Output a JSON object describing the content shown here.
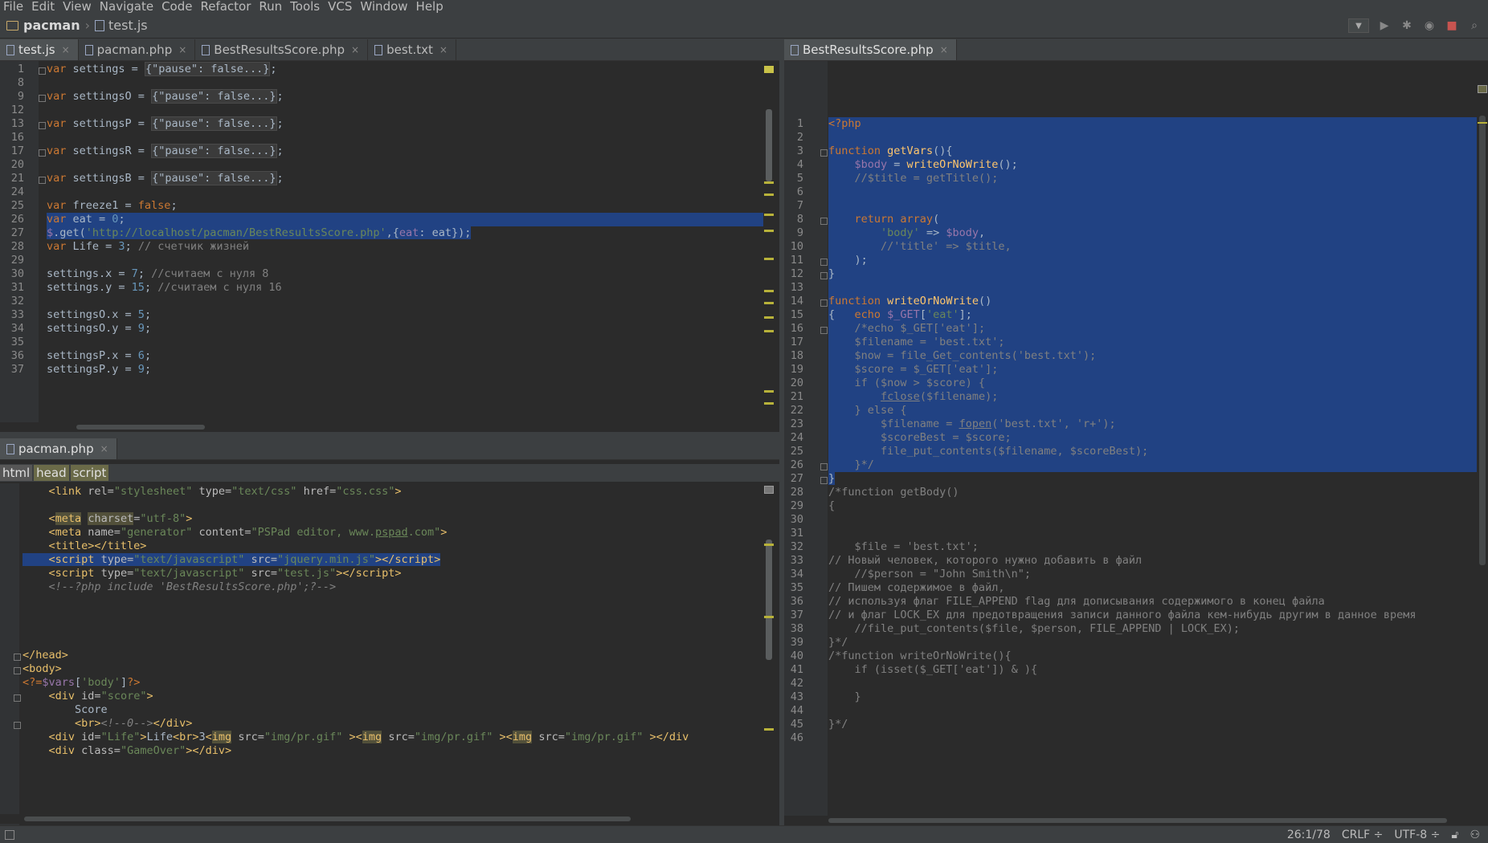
{
  "menu": [
    "File",
    "Edit",
    "View",
    "Navigate",
    "Code",
    "Refactor",
    "Run",
    "Tools",
    "VCS",
    "Window",
    "Help"
  ],
  "menu_underline": [
    "F",
    "E",
    "V",
    "N",
    "C",
    "R",
    "R",
    "T",
    "S",
    "W",
    "H"
  ],
  "nav": {
    "project": "pacman",
    "file": "test.js"
  },
  "left_top_tabs": [
    {
      "label": "test.js",
      "active": true
    },
    {
      "label": "pacman.php",
      "active": false
    },
    {
      "label": "BestResultsScore.php",
      "active": false
    },
    {
      "label": "best.txt",
      "active": false
    }
  ],
  "left_bottom_tabs": [
    {
      "label": "pacman.php",
      "active": true
    }
  ],
  "right_tabs": [
    {
      "label": "BestResultsScore.php",
      "active": true
    }
  ],
  "html_breadcrumb": [
    "html",
    "head",
    "script"
  ],
  "status": {
    "position": "26:1/78",
    "line_sep": "CRLF ÷",
    "encoding": "UTF-8 ÷"
  },
  "editor_top": {
    "lines": [
      {
        "n": "1",
        "h": "<span class='kw'>var</span> settings = <span class='fd'>{\"pause\": false...}</span>;",
        "fold": true
      },
      {
        "n": "8",
        "h": ""
      },
      {
        "n": "9",
        "h": "<span class='kw'>var</span> settingsO = <span class='fd'>{\"pause\": false...}</span>;",
        "fold": true
      },
      {
        "n": "12",
        "h": ""
      },
      {
        "n": "13",
        "h": "<span class='kw'>var</span> settingsP = <span class='fd'>{\"pause\": false...}</span>;",
        "fold": true
      },
      {
        "n": "16",
        "h": ""
      },
      {
        "n": "17",
        "h": "<span class='kw'>var</span> settingsR = <span class='fd'>{\"pause\": false...}</span>;",
        "fold": true
      },
      {
        "n": "20",
        "h": ""
      },
      {
        "n": "21",
        "h": "<span class='kw'>var</span> settingsB = <span class='fd'>{\"pause\": false...}</span>;",
        "fold": true
      },
      {
        "n": "24",
        "h": ""
      },
      {
        "n": "25",
        "h": "<span class='kw'>var</span> freeze1 = <span class='kw'>false</span>;"
      },
      {
        "n": "26",
        "h": "<span class='kw'>var</span> eat = <span class='num'>0</span>;",
        "sel": "full"
      },
      {
        "n": "27",
        "h": "<span class='var'>$</span>.get(<span class='str'>'http://localhost/pacman/BestResultsScore.php'</span>,{<span class='var'>eat</span>: eat});",
        "sel": "text"
      },
      {
        "n": "28",
        "h": "<span class='kw'>var</span> Life = <span class='num'>3</span>; <span class='cmt'>// счетчик жизней</span>"
      },
      {
        "n": "29",
        "h": ""
      },
      {
        "n": "30",
        "h": "settings.x = <span class='num'>7</span>; <span class='cmt'>//считаем с нуля 8</span>"
      },
      {
        "n": "31",
        "h": "settings.y = <span class='num'>15</span>; <span class='cmt'>//считаем с нуля 16</span>"
      },
      {
        "n": "32",
        "h": ""
      },
      {
        "n": "33",
        "h": "settingsO.x = <span class='num'>5</span>;"
      },
      {
        "n": "34",
        "h": "settingsO.y = <span class='num'>9</span>;"
      },
      {
        "n": "35",
        "h": ""
      },
      {
        "n": "36",
        "h": "settingsP.x = <span class='num'>6</span>;"
      },
      {
        "n": "37",
        "h": "settingsP.y = <span class='num'>9</span>;"
      }
    ]
  },
  "editor_bottom": {
    "lines": [
      {
        "h": "    <span class='tag'>&lt;link</span> <span class='attr'>rel=</span><span class='str'>\"stylesheet\"</span> <span class='attr'>type=</span><span class='str'>\"text/css\"</span> <span class='attr'>href=</span><span class='str'>\"css.css\"</span><span class='tag'>&gt;</span>"
      },
      {
        "h": ""
      },
      {
        "h": "    <span class='tag'>&lt;<span class='hl'>meta</span></span> <span class='attr hl'>charset</span><span class='attr'>=</span><span class='str'>\"utf-8\"</span><span class='tag'>&gt;</span>"
      },
      {
        "h": "    <span class='tag'>&lt;meta</span> <span class='attr'>name=</span><span class='str'>\"generator\"</span> <span class='attr'>content=</span><span class='str'>\"PSPad editor, www.<u>pspad</u>.com\"</span><span class='tag'>&gt;</span>"
      },
      {
        "h": "    <span class='tag'>&lt;title&gt;&lt;/title&gt;</span>"
      },
      {
        "h": "    <span class='tag'>&lt;script</span> <span class='attr'>type=</span><span class='str'>\"text/javascript\"</span> <span class='attr'>src=</span><span class='str'>\"jquery.min.js\"</span><span class='tag'>&gt;&lt;/script&gt;</span>",
        "sel": "text"
      },
      {
        "h": "    <span class='tag'>&lt;script</span> <span class='attr'>type=</span><span class='str'>\"text/javascript\"</span> <span class='attr'>src=</span><span class='str'>\"test.js\"</span><span class='tag'>&gt;&lt;/script&gt;</span>"
      },
      {
        "h": "    <span class='cmt'><i>&lt;!--?php include 'BestResultsScore.php';?--&gt;</i></span>"
      },
      {
        "h": ""
      },
      {
        "h": ""
      },
      {
        "h": ""
      },
      {
        "h": ""
      },
      {
        "h": "<span class='tag'>&lt;/head&gt;</span>",
        "fold": true
      },
      {
        "h": "<span class='tag'>&lt;body&gt;</span>",
        "fold": true
      },
      {
        "h": "<span class='kw'>&lt;?=</span><span class='var'>$vars</span>[<span class='str'>'body'</span>]<span class='kw'>?&gt;</span>"
      },
      {
        "h": "    <span class='tag'>&lt;div</span> <span class='attr'>id=</span><span class='str'>\"score\"</span><span class='tag'>&gt;</span>",
        "fold": true
      },
      {
        "h": "        Score"
      },
      {
        "h": "        <span class='tag'>&lt;br&gt;</span><span class='cmt'><i>&lt;!--0--&gt;</i></span><span class='tag'>&lt;/div&gt;</span>",
        "fold": true
      },
      {
        "h": "    <span class='tag'>&lt;div</span> <span class='attr'>id=</span><span class='str'>\"Life\"</span><span class='tag'>&gt;</span>Life<span class='tag'>&lt;br&gt;</span>3<span class='tag'>&lt;<span class='hl'>img</span></span> <span class='attr'>src=</span><span class='str'>\"img/pr.gif\"</span> <span class='tag'>&gt;&lt;<span class='hl'>img</span></span> <span class='attr'>src=</span><span class='str'>\"img/pr.gif\"</span> <span class='tag'>&gt;&lt;<span class='hl'>img</span></span> <span class='attr'>src=</span><span class='str'>\"img/pr.gif\"</span> <span class='tag'>&gt;&lt;/div</span>"
      },
      {
        "h": "    <span class='tag'>&lt;div</span> <span class='attr'>class=</span><span class='str'>\"GameOver\"</span><span class='tag'>&gt;&lt;/div&gt;</span>"
      }
    ]
  },
  "editor_right": {
    "lines": [
      {
        "n": "1",
        "h": "<span class='kw'>&lt;?php</span>",
        "sel": "full"
      },
      {
        "n": "2",
        "h": "",
        "sel": "full"
      },
      {
        "n": "3",
        "h": "<span class='kw'>function</span> <span class='fn'>getVars</span>(){",
        "sel": "full",
        "fold": true
      },
      {
        "n": "4",
        "h": "    <span class='var'>$body</span> = <span class='fn'>writeOrNoWrite</span>();",
        "sel": "full"
      },
      {
        "n": "5",
        "h": "    <span class='cmt'>//$title = getTitle();</span>",
        "sel": "full"
      },
      {
        "n": "6",
        "h": "",
        "sel": "full"
      },
      {
        "n": "7",
        "h": "",
        "sel": "full"
      },
      {
        "n": "8",
        "h": "    <span class='kw'>return array</span>(",
        "sel": "full",
        "fold": true
      },
      {
        "n": "9",
        "h": "        <span class='str'>'body'</span> => <span class='var'>$body</span>,",
        "sel": "full"
      },
      {
        "n": "10",
        "h": "        <span class='cmt'>//'title' => $title,</span>",
        "sel": "full"
      },
      {
        "n": "11",
        "h": "    );",
        "sel": "full",
        "fold": true
      },
      {
        "n": "12",
        "h": "}",
        "sel": "full",
        "fold": true
      },
      {
        "n": "13",
        "h": "",
        "sel": "full"
      },
      {
        "n": "14",
        "h": "<span class='kw'>function</span> <span class='fn'>writeOrNoWrite</span>()",
        "sel": "full",
        "fold": true
      },
      {
        "n": "15",
        "h": "{   <span class='kw'>echo</span> <span class='var'>$_GET</span>[<span class='str'>'eat'</span>];",
        "sel": "full"
      },
      {
        "n": "16",
        "h": "    <span class='cmt'>/*echo $_GET['eat'];</span>",
        "sel": "full",
        "fold": true
      },
      {
        "n": "17",
        "h": "<span class='cmt'>    $filename = 'best.txt';</span>",
        "sel": "full"
      },
      {
        "n": "18",
        "h": "<span class='cmt'>    $now = file_Get_contents('best.txt');</span>",
        "sel": "full"
      },
      {
        "n": "19",
        "h": "<span class='cmt'>    $score = $_GET['eat'];</span>",
        "sel": "full"
      },
      {
        "n": "20",
        "h": "<span class='cmt'>    if ($now &gt; $score) {</span>",
        "sel": "full"
      },
      {
        "n": "21",
        "h": "<span class='cmt'>        <u>fclose</u>($filename);</span>",
        "sel": "full"
      },
      {
        "n": "22",
        "h": "<span class='cmt'>    } else {</span>",
        "sel": "full"
      },
      {
        "n": "23",
        "h": "<span class='cmt'>        $filename = <u>fopen</u>('best.txt', 'r+');</span>",
        "sel": "full"
      },
      {
        "n": "24",
        "h": "<span class='cmt'>        $scoreBest = $score;</span>",
        "sel": "full"
      },
      {
        "n": "25",
        "h": "<span class='cmt'>        file_put_contents($filename, $scoreBest);</span>",
        "sel": "full"
      },
      {
        "n": "26",
        "h": "<span class='cmt'>    }*/</span>",
        "sel": "full",
        "fold": true
      },
      {
        "n": "27",
        "h": "}",
        "sel": "text",
        "fold": true
      },
      {
        "n": "28",
        "h": "<span class='cmt'>/*function getBody()</span>"
      },
      {
        "n": "29",
        "h": "<span class='cmt'>{</span>"
      },
      {
        "n": "30",
        "h": ""
      },
      {
        "n": "31",
        "h": ""
      },
      {
        "n": "32",
        "h": "<span class='cmt'>    $file = 'best.txt';</span>"
      },
      {
        "n": "33",
        "h": "<span class='cmt'>// Новый человек, которого нужно добавить в файл</span>"
      },
      {
        "n": "34",
        "h": "<span class='cmt'>    //$person = \"John Smith\\n\";</span>"
      },
      {
        "n": "35",
        "h": "<span class='cmt'>// Пишем содержимое в файл,</span>"
      },
      {
        "n": "36",
        "h": "<span class='cmt'>// используя флаг FILE_APPEND flag для дописывания содержимого в конец файла</span>"
      },
      {
        "n": "37",
        "h": "<span class='cmt'>// и флаг LOCK_EX для предотвращения записи данного файла кем-нибудь другим в данное время</span>"
      },
      {
        "n": "38",
        "h": "<span class='cmt'>    //file_put_contents($file, $person, FILE_APPEND | LOCK_EX);</span>"
      },
      {
        "n": "39",
        "h": "<span class='cmt'>}*/</span>"
      },
      {
        "n": "40",
        "h": "<span class='cmt'>/*function writeOrNoWrite(){</span>"
      },
      {
        "n": "41",
        "h": "<span class='cmt'>    if (isset($_GET['eat']) &amp; ){</span>"
      },
      {
        "n": "42",
        "h": ""
      },
      {
        "n": "43",
        "h": "<span class='cmt'>    }</span>"
      },
      {
        "n": "44",
        "h": ""
      },
      {
        "n": "45",
        "h": "<span class='cmt'>}*/</span>"
      },
      {
        "n": "46",
        "h": ""
      }
    ]
  },
  "colors": {
    "background": "#2b2b2b",
    "panel": "#3c3f41",
    "selection": "#214283",
    "keyword": "#cc7832",
    "string": "#6a8759"
  }
}
